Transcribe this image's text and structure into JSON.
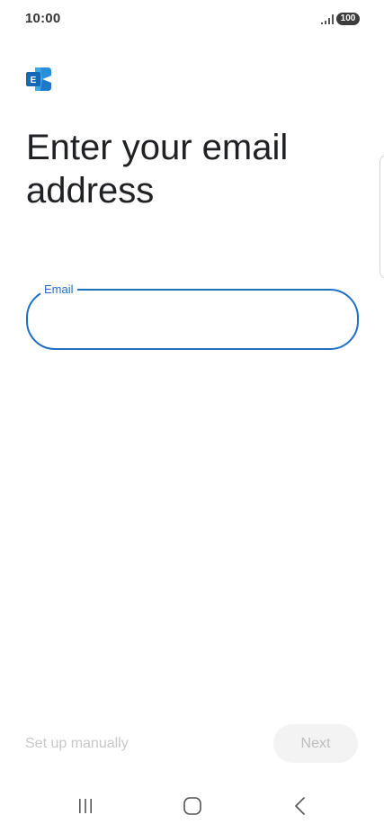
{
  "status_bar": {
    "time": "10:00",
    "battery": "100"
  },
  "app": {
    "logo_letter": "E",
    "colors": {
      "logo_dark": "#1a73c5",
      "logo_light": "#39a9e6",
      "accent": "#1f6fc7"
    }
  },
  "page": {
    "title": "Enter your email address"
  },
  "email_field": {
    "label": "Email",
    "value": ""
  },
  "footer": {
    "setup_manually": "Set up manually",
    "next": "Next"
  },
  "nav_bar": {
    "icons": [
      "recents-icon",
      "home-icon",
      "back-icon"
    ]
  }
}
